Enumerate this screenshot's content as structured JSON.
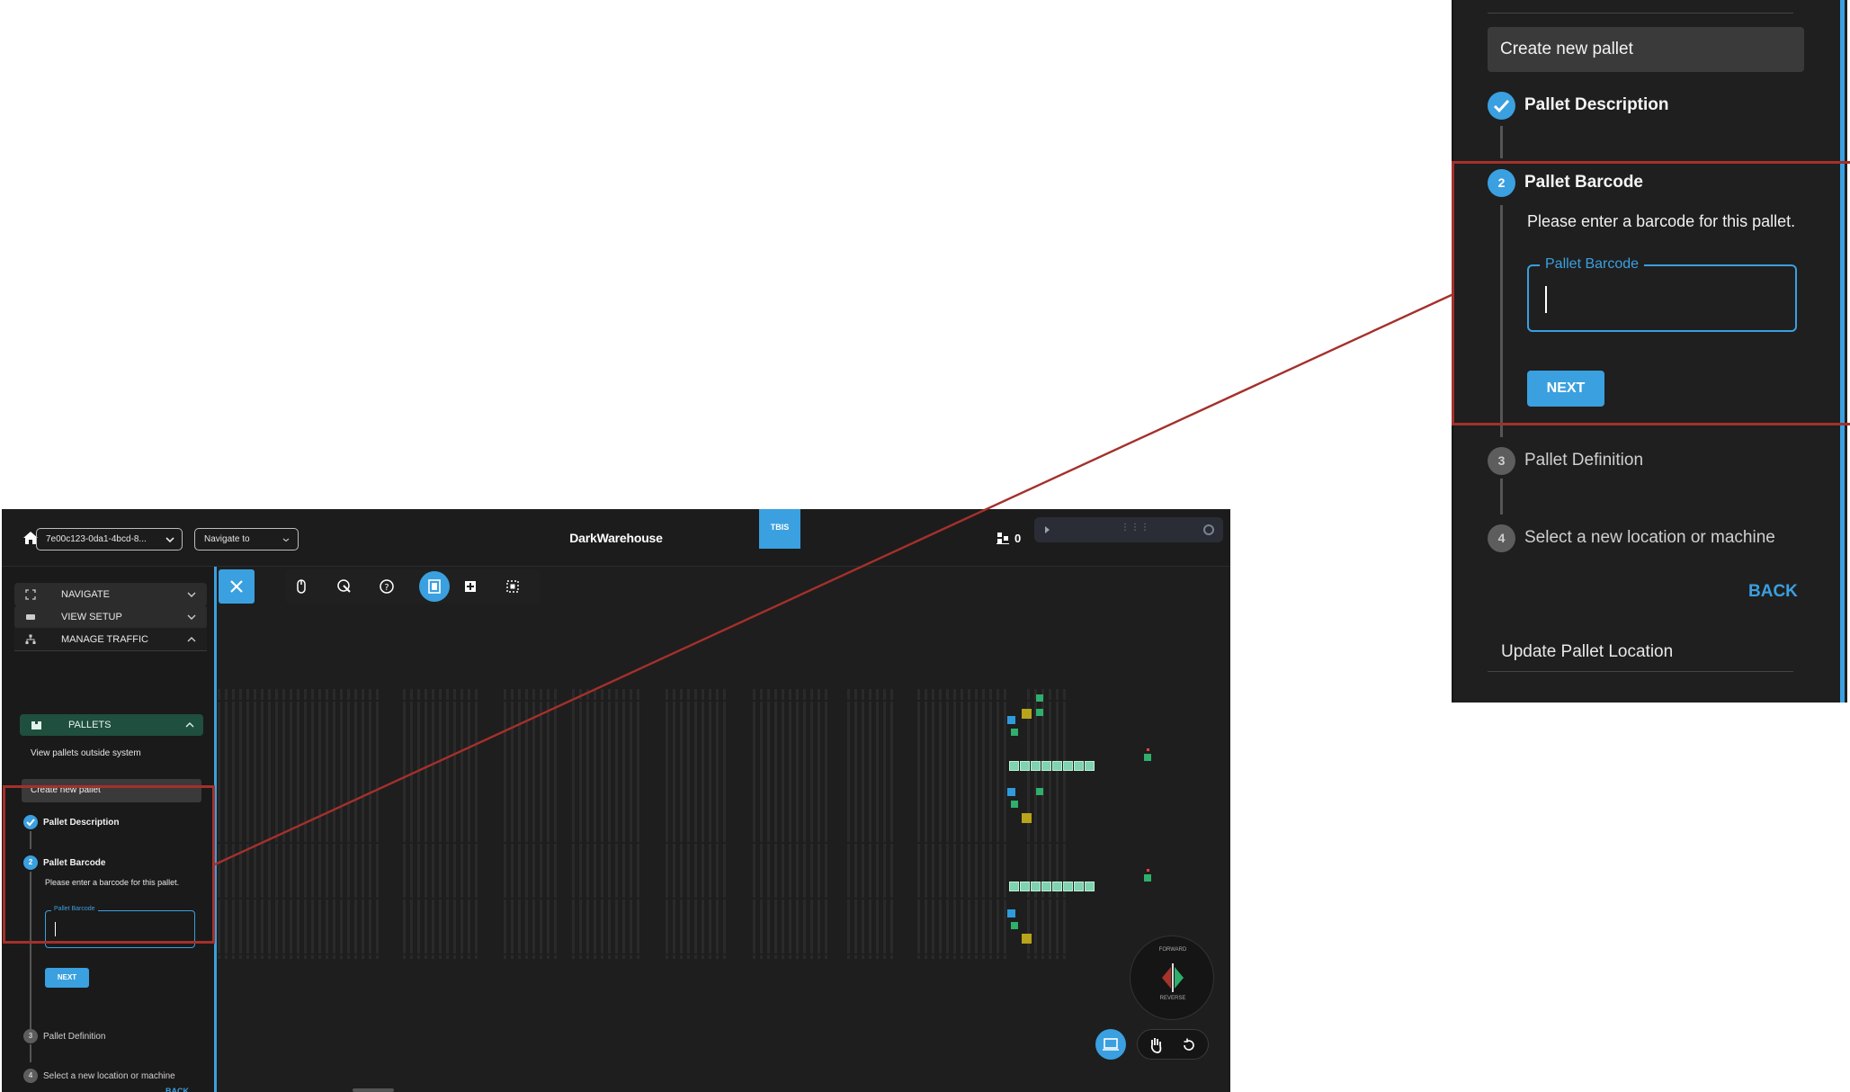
{
  "topbar": {
    "session_select": "7e00c123-0da1-4bcd-8...",
    "navigate_select": "Navigate to",
    "title": "DarkWarehouse",
    "badge": "TBIS",
    "pallet_count": "0"
  },
  "sidebar": {
    "navigate": "NAVIGATE",
    "view_setup": "VIEW SETUP",
    "manage_traffic": "MANAGE TRAFFIC",
    "pallets": "PALLETS",
    "view_outside": "View pallets outside system",
    "create_new_pallet": "Create new pallet",
    "update_pallet_location": "Update Pallet Location"
  },
  "wizard": {
    "steps": [
      {
        "number": "1",
        "label": "Pallet Description"
      },
      {
        "number": "2",
        "label": "Pallet Barcode"
      },
      {
        "number": "3",
        "label": "Pallet Definition"
      },
      {
        "number": "4",
        "label": "Select a new location or machine"
      }
    ],
    "barcode_prompt": "Please enter a barcode for this pallet.",
    "barcode_field_label": "Pallet Barcode",
    "barcode_value": "",
    "next": "NEXT",
    "back": "BACK"
  },
  "direction": {
    "forward": "FORWARD",
    "reverse": "REVERSE"
  },
  "colors": {
    "accent": "#3aa0e0",
    "pallets_active": "#1f4f3e",
    "highlight_frame": "#a5302b"
  }
}
